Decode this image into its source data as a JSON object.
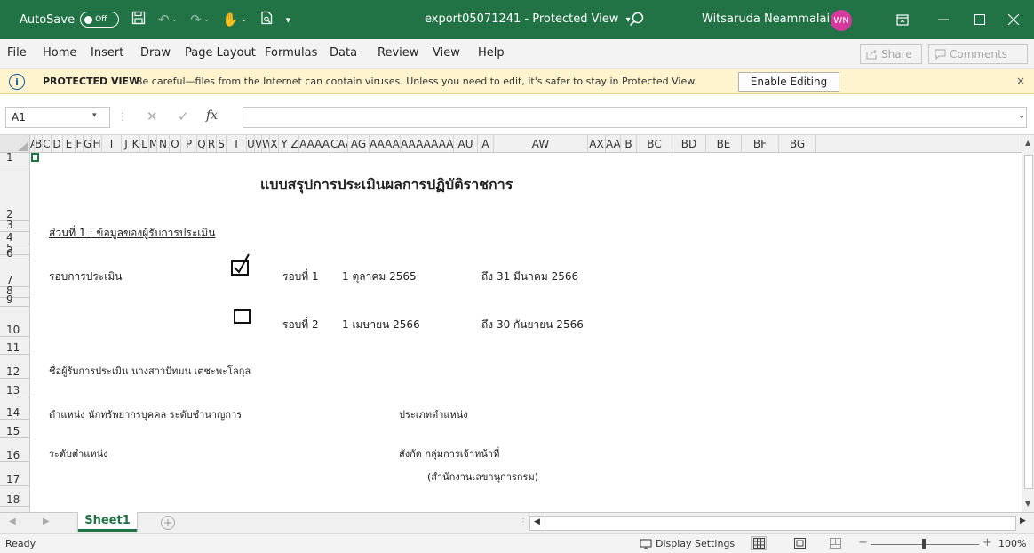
{
  "titlebar": {
    "autosave_label": "AutoSave",
    "autosave_state": "Off",
    "doc_title": "export05071241  -  Protected View",
    "doc_title_caret": "▾",
    "user_name": "Witsaruda Neammalai",
    "user_initials": "WN",
    "accent_color": "#217346"
  },
  "menu": {
    "items": [
      "File",
      "Home",
      "Insert",
      "Draw",
      "Page Layout",
      "Formulas",
      "Data",
      "Review",
      "View",
      "Help"
    ],
    "share_label": "Share",
    "comments_label": "Comments"
  },
  "protected_view": {
    "label": "PROTECTED VIEW",
    "message": "Be careful—files from the Internet can contain viruses. Unless you need to edit, it's safer to stay in Protected View.",
    "enable_button": "Enable Editing",
    "close_glyph": "×",
    "icon_glyph": "i"
  },
  "formula_bar": {
    "name_box": "A1",
    "fx_label": "fx",
    "formula_value": ""
  },
  "columns": [
    "A",
    "B",
    "C",
    "D",
    "E",
    "F",
    "G",
    "H",
    "I",
    "J",
    "K",
    "L",
    "M",
    "N",
    "O",
    "P",
    "Q",
    "R",
    "S",
    "T",
    "U",
    "V",
    "W",
    "X",
    "Y",
    "Z",
    "AAAA",
    "CAA",
    "AG",
    "AAAAK",
    "AAAAAAAAA",
    "AU",
    "A",
    "AW",
    "AX",
    "AAB",
    "B",
    "BC",
    "BD",
    "BE",
    "BF",
    "BG"
  ],
  "rows": [
    "1",
    "2",
    "3",
    "4",
    "5",
    "6",
    "7",
    "8",
    "9",
    "10",
    "11",
    "12",
    "13",
    "14",
    "15",
    "16",
    "17",
    "18"
  ],
  "sheet": {
    "title": "แบบสรุปการประเมินผลการปฏิบัติราชการ",
    "part1": "ส่วนที่ 1 : ข้อมูลของผู้รับการประเมิน",
    "round_label": "รอบการประเมิน",
    "round1": {
      "checked": true,
      "label": "รอบที่ 1",
      "start": "1 ตุลาคม  2565",
      "end": "ถึง  31  มีนาคม  2566"
    },
    "round2": {
      "checked": false,
      "label": "รอบที่ 2",
      "start": "1 เมษายน  2566",
      "end": "ถึง  30  กันยายน  2566"
    },
    "evaluatee": "ชื่อผู้รับการประเมิน  นางสาวปัทมน เตชะพะโลกุล",
    "position": "ตำแหน่ง  นักทรัพยากรบุคคล ระดับชำนาญการ",
    "position_type": "ประเภทตำแหน่ง",
    "position_level": "ระดับตำแหน่ง",
    "affiliation": "สังกัด  กลุ่มการเจ้าหน้าที่",
    "affiliation_sub": "(สำนักงานเลขานุการกรม)"
  },
  "tabs": {
    "sheet_name": "Sheet1",
    "new_sheet": "+"
  },
  "status": {
    "ready": "Ready",
    "display_settings": "Display Settings",
    "zoom": "100%",
    "zoom_fraction": 0.5
  }
}
